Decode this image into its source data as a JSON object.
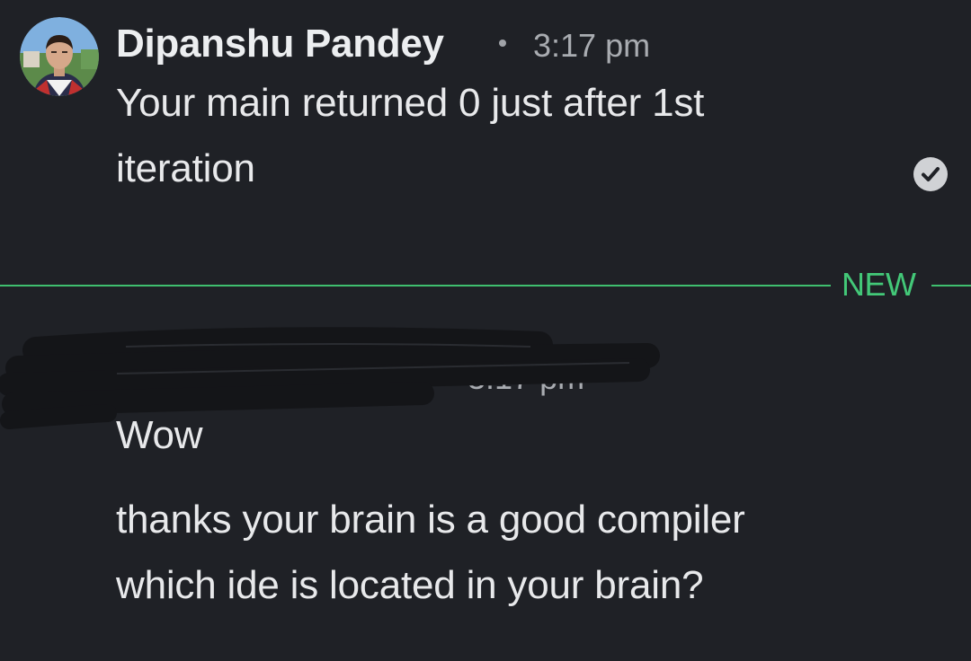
{
  "message1": {
    "author": "Dipanshu Pandey",
    "time": "3:17 pm",
    "text_line1": "Your main returned 0 just after 1st",
    "text_line2": "iteration",
    "read_status_icon": "check-circle-icon"
  },
  "divider": {
    "label": "NEW",
    "color": "#3fbf6f"
  },
  "message2": {
    "time": "3:17 pm",
    "text": "Wow"
  },
  "message3": {
    "text_line1": "thanks your brain is a good compiler",
    "text_line2": "which ide is located in your brain?"
  },
  "colors": {
    "background": "#1f2126",
    "accent": "#43c878"
  }
}
